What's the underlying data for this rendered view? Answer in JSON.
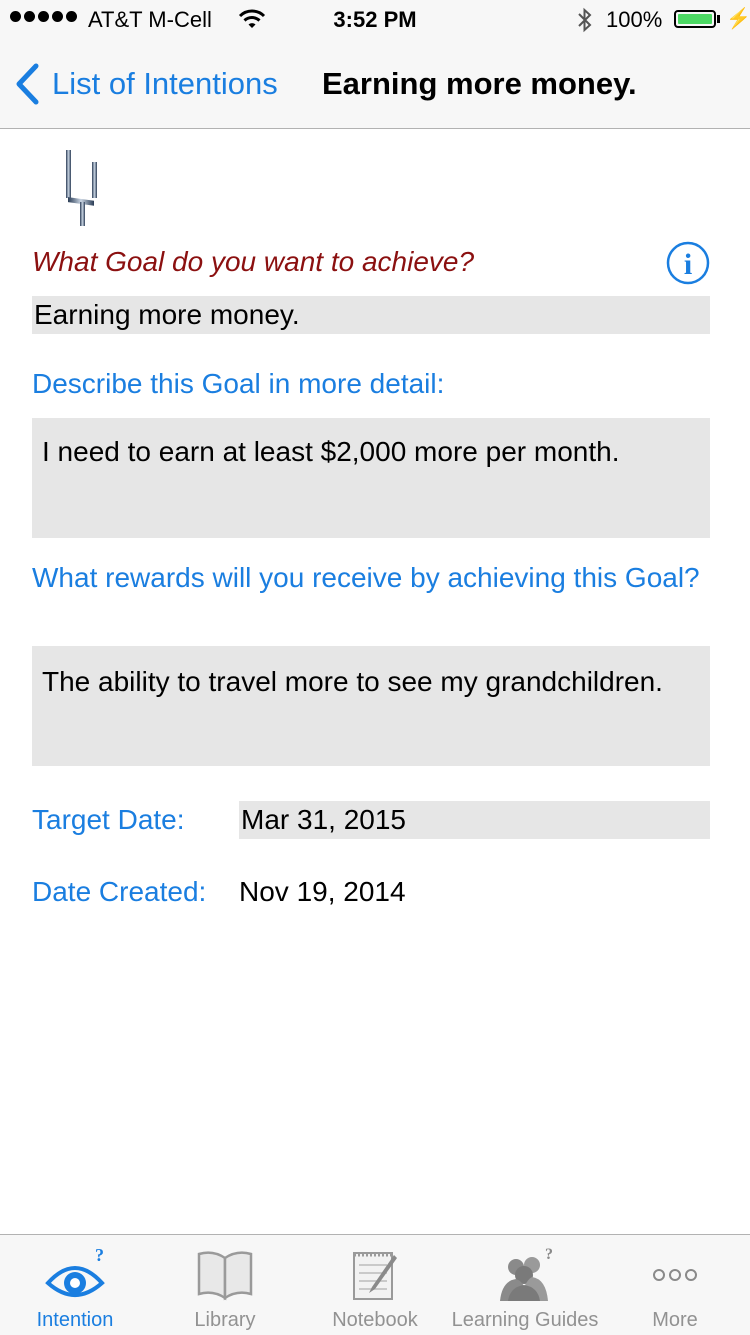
{
  "status_bar": {
    "carrier": "AT&T M-Cell",
    "time": "3:52 PM",
    "battery_percent": "100%",
    "battery_level": 1.0
  },
  "nav": {
    "back_label": "List of Intentions",
    "title": "Earning more money."
  },
  "form": {
    "goal_question": "What Goal do you want to achieve?",
    "goal_value": "Earning more money.",
    "detail_label": "Describe this Goal in more detail:",
    "detail_value": "I need to earn at least $2,000 more per month.",
    "rewards_label": "What rewards will you receive by achieving this Goal?",
    "rewards_value": "The ability to travel more to see my grandchildren.",
    "target_date_label": "Target Date:",
    "target_date_value": "Mar 31, 2015",
    "created_label": "Date Created:",
    "created_value": "Nov 19, 2014"
  },
  "tabs": [
    {
      "label": "Intention",
      "icon": "eye-question-icon",
      "active": true
    },
    {
      "label": "Library",
      "icon": "book-icon",
      "active": false
    },
    {
      "label": "Notebook",
      "icon": "notebook-icon",
      "active": false
    },
    {
      "label": "Learning Guides",
      "icon": "people-question-icon",
      "active": false
    },
    {
      "label": "More",
      "icon": "more-dots-icon",
      "active": false
    }
  ],
  "colors": {
    "accent": "#1a7ee0",
    "question": "#8b1010",
    "field_bg": "#e6e6e6",
    "battery": "#4cd964"
  }
}
